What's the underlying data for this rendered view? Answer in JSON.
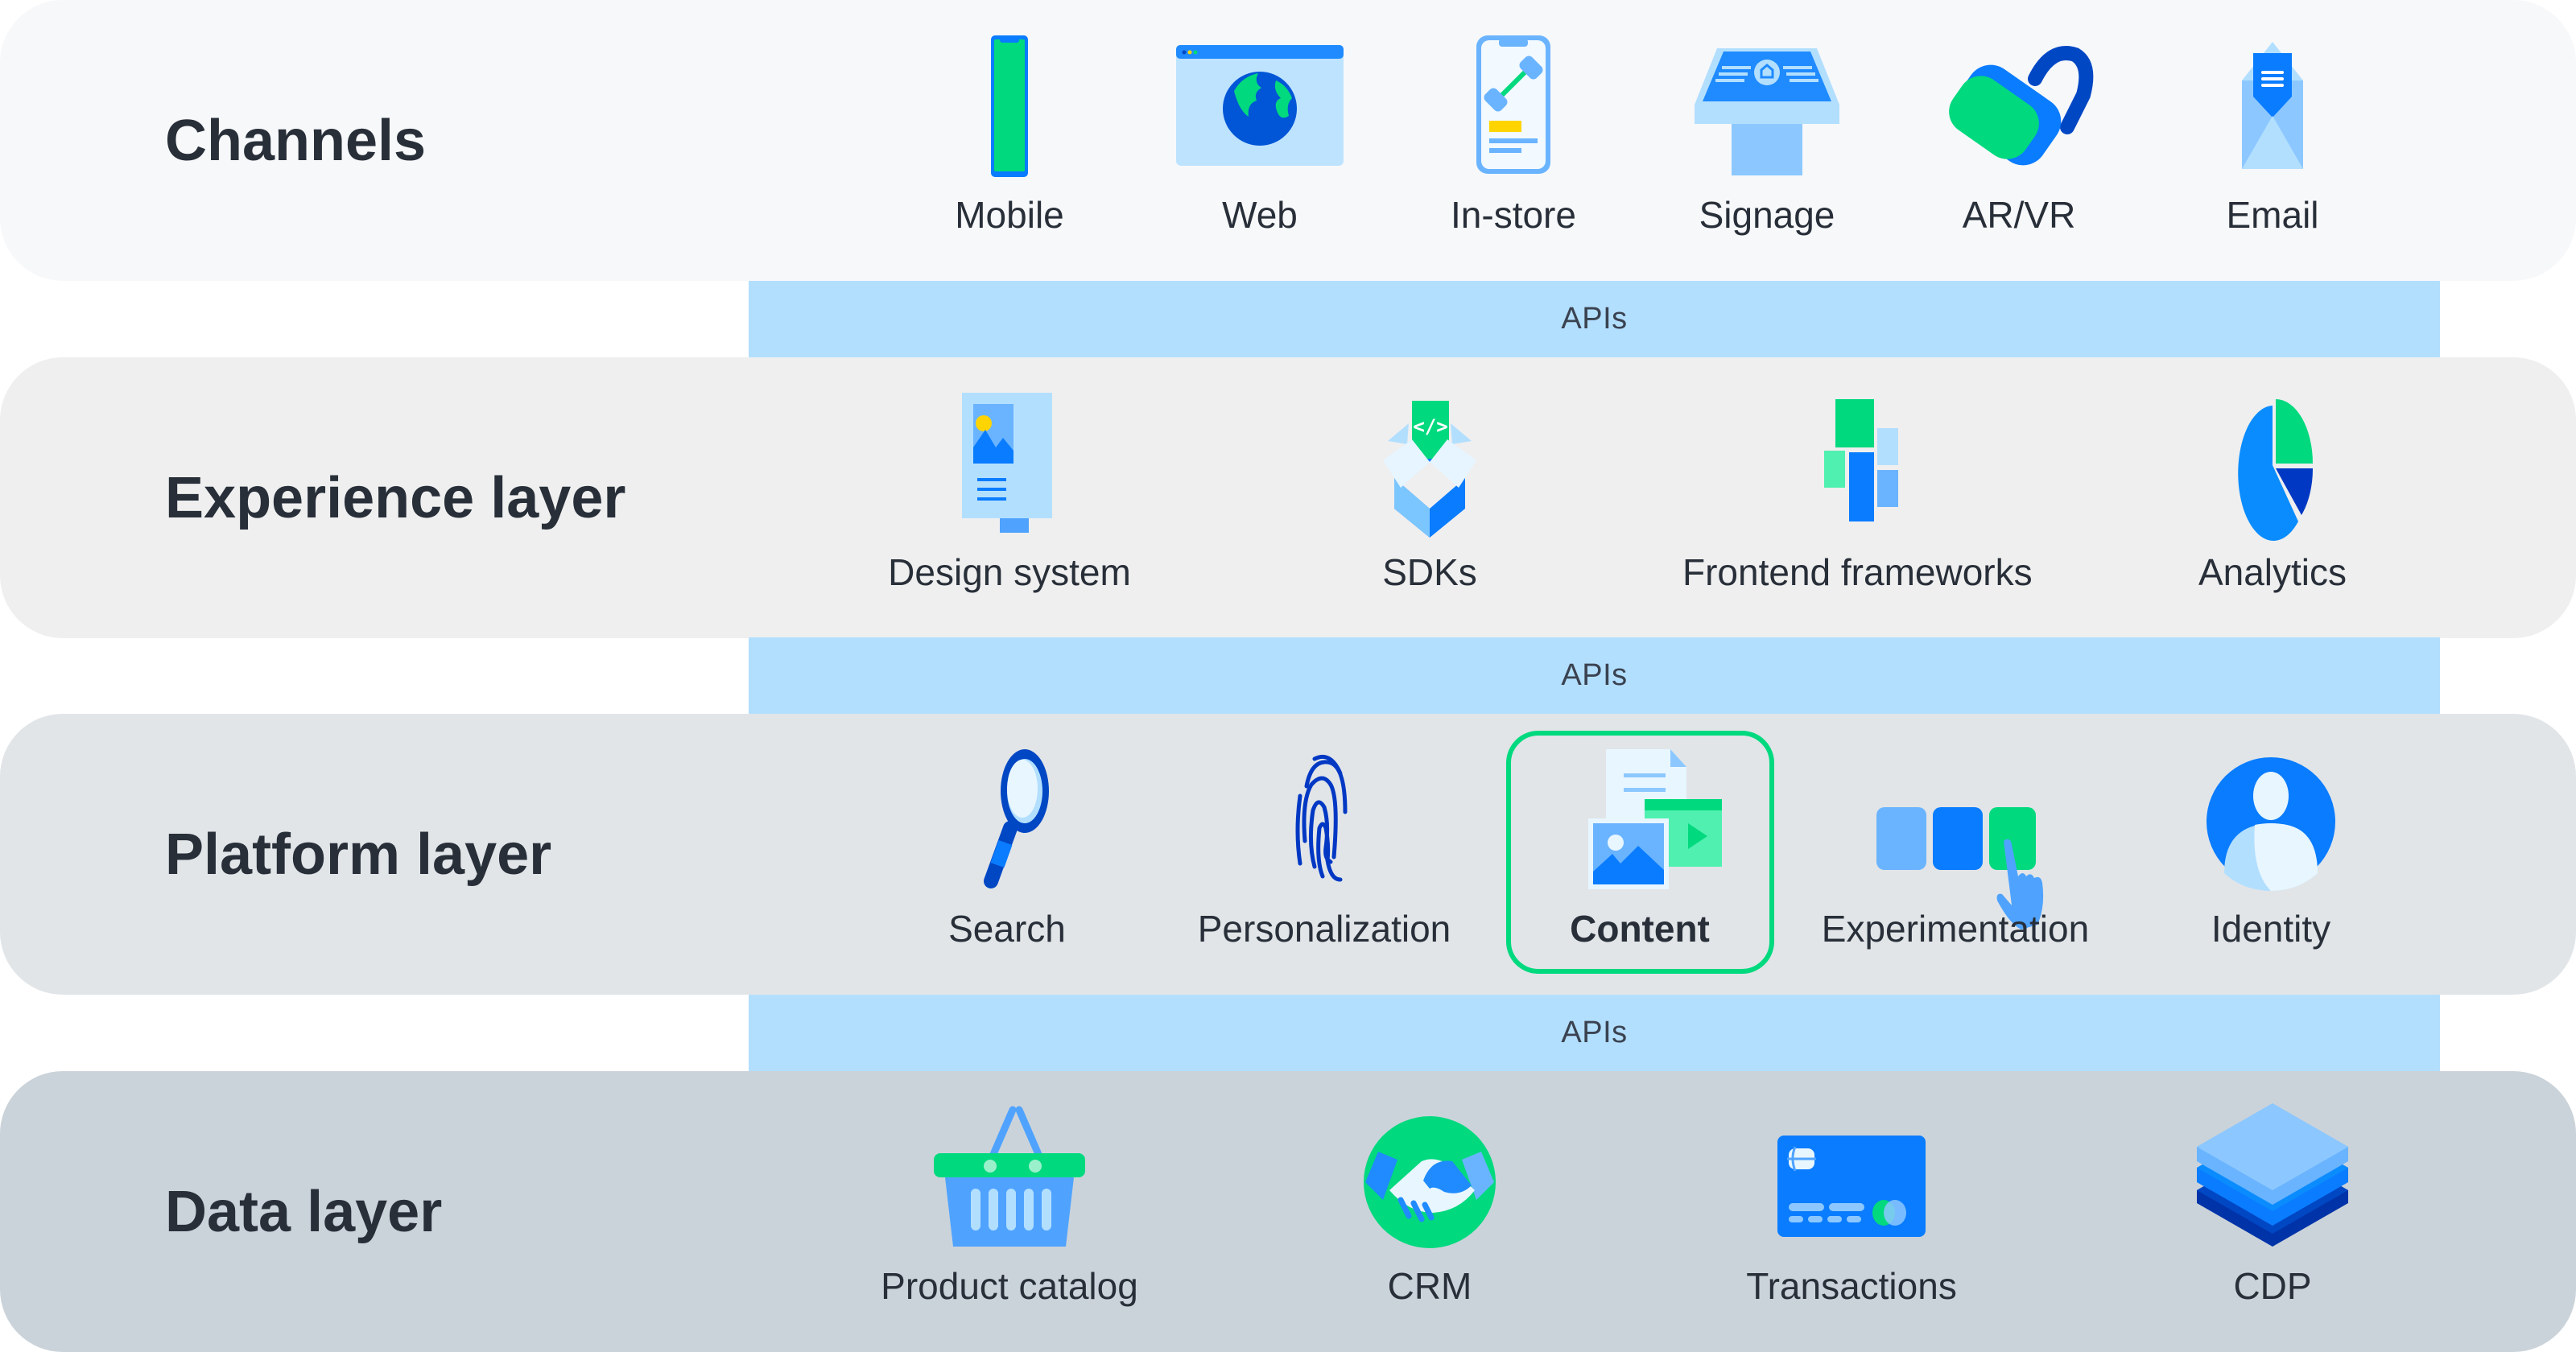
{
  "colors": {
    "title_text": "#282F39",
    "api_band": "#B3DFFF",
    "highlight_border": "#00D97E",
    "panel_channels": "#F7F8FA",
    "panel_experience": "#EFEFEF",
    "panel_platform": "#E1E5E8",
    "panel_data": "#CBD3DA"
  },
  "api_bands": [
    {
      "label": "APIs"
    },
    {
      "label": "APIs"
    },
    {
      "label": "APIs"
    }
  ],
  "layers": [
    {
      "title": "Channels",
      "items": [
        {
          "label": "Mobile",
          "icon": "mobile-phone-icon"
        },
        {
          "label": "Web",
          "icon": "browser-globe-icon"
        },
        {
          "label": "In-store",
          "icon": "phone-dumbbell-icon"
        },
        {
          "label": "Signage",
          "icon": "kiosk-sign-icon"
        },
        {
          "label": "AR/VR",
          "icon": "vr-headset-icon"
        },
        {
          "label": "Email",
          "icon": "envelope-icon"
        }
      ]
    },
    {
      "title": "Experience layer",
      "items": [
        {
          "label": "Design system",
          "icon": "design-doc-icon"
        },
        {
          "label": "SDKs",
          "icon": "code-box-icon"
        },
        {
          "label": "Frontend frameworks",
          "icon": "blocks-icon"
        },
        {
          "label": "Analytics",
          "icon": "pie-chart-icon"
        }
      ]
    },
    {
      "title": "Platform layer",
      "items": [
        {
          "label": "Search",
          "icon": "magnifier-icon"
        },
        {
          "label": "Personalization",
          "icon": "fingerprint-icon"
        },
        {
          "label": "Content",
          "icon": "content-media-icon",
          "highlighted": true
        },
        {
          "label": "Experimentation",
          "icon": "ab-test-hand-icon"
        },
        {
          "label": "Identity",
          "icon": "user-avatar-icon"
        }
      ]
    },
    {
      "title": "Data layer",
      "items": [
        {
          "label": "Product catalog",
          "icon": "basket-icon"
        },
        {
          "label": "CRM",
          "icon": "handshake-icon"
        },
        {
          "label": "Transactions",
          "icon": "credit-card-icon"
        },
        {
          "label": "CDP",
          "icon": "layers-stack-icon"
        }
      ]
    }
  ]
}
